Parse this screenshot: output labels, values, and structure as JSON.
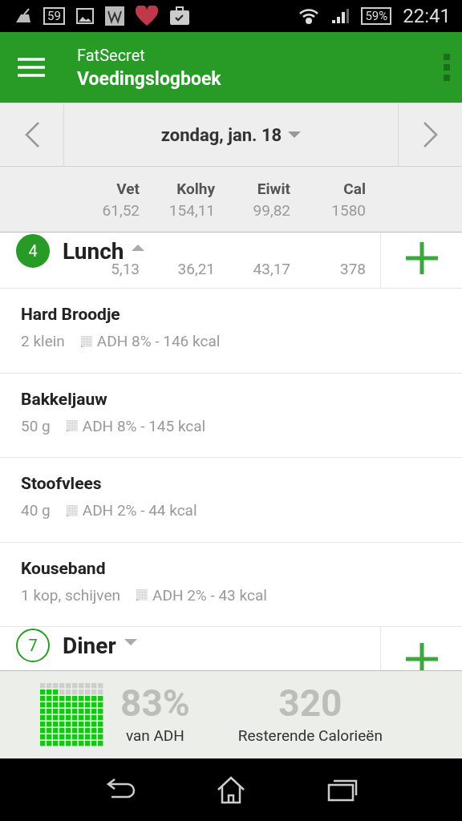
{
  "status_bar": {
    "notification_count": "59",
    "battery": "59%",
    "time": "22:41"
  },
  "app_bar": {
    "app_name": "FatSecret",
    "title": "Voedingslogboek"
  },
  "date_bar": {
    "date": "zondag, jan. 18"
  },
  "totals": [
    {
      "label": "Vet",
      "value": "61,52"
    },
    {
      "label": "Kolhy",
      "value": "154,11"
    },
    {
      "label": "Eiwit",
      "value": "99,82"
    },
    {
      "label": "Cal",
      "value": "1580"
    }
  ],
  "meals": [
    {
      "number": "4",
      "name": "Lunch",
      "expanded": true,
      "values": [
        "5,13",
        "36,21",
        "43,17",
        "378"
      ],
      "entries": [
        {
          "name": "Hard Broodje",
          "portion": "2 klein",
          "summary": "ADH 8% - 146 kcal"
        },
        {
          "name": "Bakkeljauw",
          "portion": "50 g",
          "summary": "ADH 8% - 145 kcal"
        },
        {
          "name": "Stoofvlees",
          "portion": "40 g",
          "summary": "ADH 2% - 44 kcal"
        },
        {
          "name": "Kouseband",
          "portion": "1 kop, schijven",
          "summary": "ADH 2% - 43 kcal"
        }
      ]
    },
    {
      "number": "7",
      "name": "Diner",
      "expanded": false
    }
  ],
  "summary": {
    "percent": "83%",
    "percent_label": "van ADH",
    "remaining": "320",
    "remaining_label": "Resterende Calorieën"
  }
}
